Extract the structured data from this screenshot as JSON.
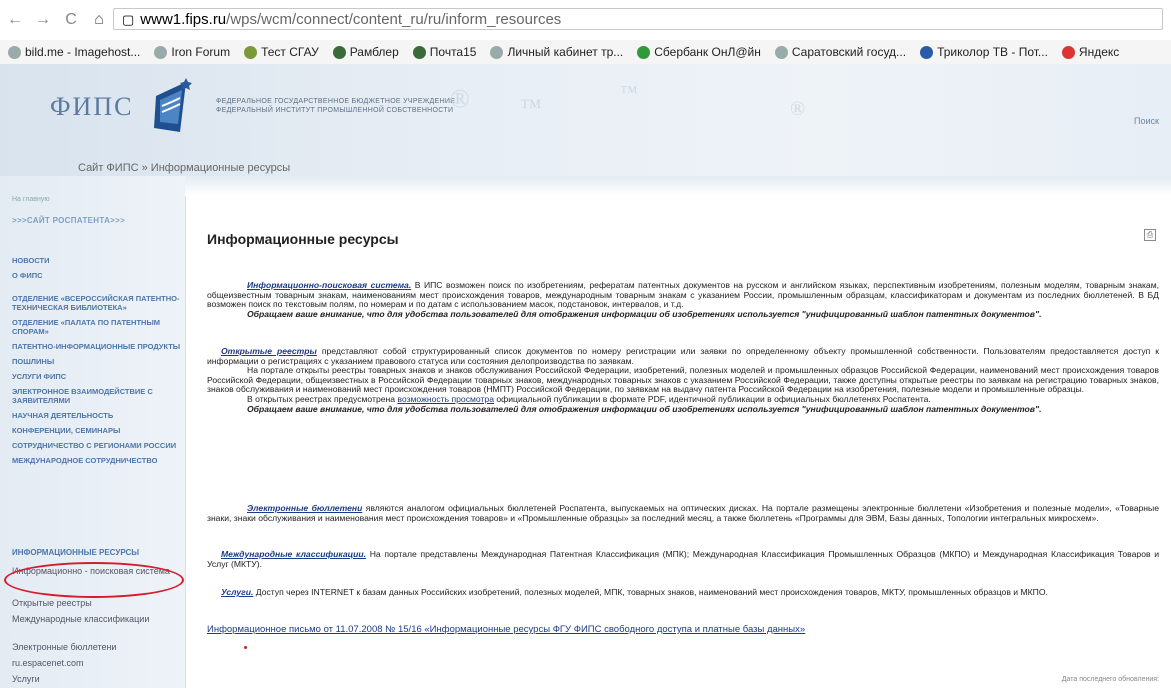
{
  "browser": {
    "nav_back": "←",
    "nav_forward": "→",
    "reload": "C",
    "home": "⌂",
    "page_icon": "▢",
    "url_host": "www1.fips.ru",
    "url_path": "/wps/wcm/connect/content_ru/ru/inform_resources",
    "bookmarks": [
      "bild.me - Imagehost...",
      "Iron Forum",
      "Тест СГАУ",
      "Рамблер",
      "Почта15",
      "Личный кабинет тр...",
      "Сбербанк ОнЛ@йн",
      "Саратовский госуд...",
      "Триколор ТВ - Пот...",
      "Яндекс"
    ]
  },
  "header": {
    "logo": "ФИПС",
    "inst_line1": "ФЕДЕРАЛЬНОЕ ГОСУДАРСТВЕННОЕ БЮДЖЕТНОЕ УЧРЕЖДЕНИЕ",
    "inst_line2": "ФЕДЕРАЛЬНЫЙ ИНСТИТУТ ПРОМЫШЛЕННОЙ СОБСТВЕННОСТИ",
    "search": "Поиск"
  },
  "breadcrumb": {
    "site": "Сайт ФИПС",
    "sep": "»",
    "page": "Информационные ресурсы"
  },
  "sidebar": {
    "top": "На главную",
    "rospatent": ">>>САЙТ РОСПАТЕНТА>>>",
    "menu": [
      "НОВОСТИ",
      "О ФИПС",
      "ОТДЕЛЕНИЕ «ВСЕРОССИЙСКАЯ ПАТЕНТНО-ТЕХНИЧЕСКАЯ БИБЛИОТЕКА»",
      "ОТДЕЛЕНИЕ «ПАЛАТА ПО ПАТЕНТНЫМ СПОРАМ»",
      "ПАТЕНТНО-ИНФОРМАЦИОННЫЕ ПРОДУКТЫ",
      "ПОШЛИНЫ",
      "УСЛУГИ ФИПС",
      "ЭЛЕКТРОННОЕ ВЗАИМОДЕЙСТВИЕ С ЗАЯВИТЕЛЯМИ",
      "НАУЧНАЯ ДЕЯТЕЛЬНОСТЬ",
      "КОНФЕРЕНЦИИ, СЕМИНАРЫ",
      "СОТРУДНИЧЕСТВО С РЕГИОНАМИ РОССИИ",
      "МЕЖДУНАРОДНОЕ СОТРУДНИЧЕСТВО"
    ],
    "section": "ИНФОРМАЦИОННЫЕ РЕСУРСЫ",
    "sub_items": [
      "Информационно - поисковая система",
      "Открытые реестры",
      "Международные классификации",
      "Электронные бюллетени",
      "ru.espacenet.com",
      "Услуги"
    ]
  },
  "main": {
    "title": "Информационные ресурсы",
    "print_icon": "⎙",
    "p1_link": "Информационно-поисковая система.",
    "p1_text": " В ИПС возможен поиск по изобретениям, рефератам патентных документов на русском и английском языках, перспективным изобретениям, полезным моделям, товарным знакам, общеизвестным товарным знакам, наименованиям мест происхождения товаров, международным товарным знакам с указанием России, промышленным образцам, классификаторам и документам из последних бюллетеней. В БД возможен поиск по текстовым полям, по номерам и по датам с использованием масок, подстановок, интервалов, и т.д.",
    "p1_note": "Обращаем ваше внимание, что для удобства пользователей для отображения информации об изобретениях используется \"унифицированный шаблон патентных документов\".",
    "p2_link": "Открытые реестры",
    "p2_text": " представляют собой структурированный список документов по номеру регистрации или заявки по определенному объекту промышленной собственности. Пользователям предоставляется доступ к информации о регистрациях с указанием правового статуса или состояния делопроизводства по заявкам.",
    "p2_text2": "На портале открыты реестры товарных знаков и знаков обслуживания Российской Федерации, изобретений, полезных моделей и промышленных образцов Российской Федерации, наименований мест происхождения товаров Российской Федерации, общеизвестных в Российской Федерации товарных знаков, международных товарных знаков с указанием Российской Федерации, также доступны открытые реестры по заявкам на регистрацию товарных знаков, знаков обслуживания и наименований мест происхождения товаров (НМПТ) Российской Федерации, по заявкам на выдачу патента Российской Федерации на изобретения, полезные модели и промышленные образцы.",
    "p2_text3a": "В открытых реестрах предусмотрена ",
    "p2_text3_link": "возможность просмотра",
    "p2_text3b": " официальной публикации в формате PDF, идентичной публикации в официальных бюллетенях Роспатента.",
    "p2_note": "Обращаем ваше внимание, что для удобства пользователей для отображения информации об изобретениях используется \"унифицированный шаблон патентных документов\".",
    "p3_link": "Электронные бюллетени",
    "p3_text": " являются аналогом официальных бюллетеней Роспатента, выпускаемых на оптических дисках. На портале размещены электронные бюллетени «Изобретения и полезные модели», «Товарные знаки, знаки обслуживания и наименования мест происхождения товаров» и «Промышленные образцы» за последний месяц, а также бюллетень «Программы для ЭВМ, Базы данных, Топологии интегральных микросхем».",
    "p4_link": "Международные классификации.",
    "p4_text": " На портале представлены Международная Патентная Классификация (МПК); Международная Классификация Промышленных Образцов (МКПО) и Международная Классификация Товаров и Услуг (МКТУ).",
    "p5_link": "Услуги.",
    "p5_text": " Доступ через INTERNET к базам данных Российских изобретений, полезных моделей, МПК, товарных знаков, наименований мест происхождения товаров, МКТУ, промышленных образцов и МКПО.",
    "info_letter": "Информационное письмо от 11.07.2008 № 15/16   «Информационные ресурсы ФГУ ФИПС свободного доступа и платные базы данных»",
    "last_updated": "Дата последнего обновления:"
  }
}
